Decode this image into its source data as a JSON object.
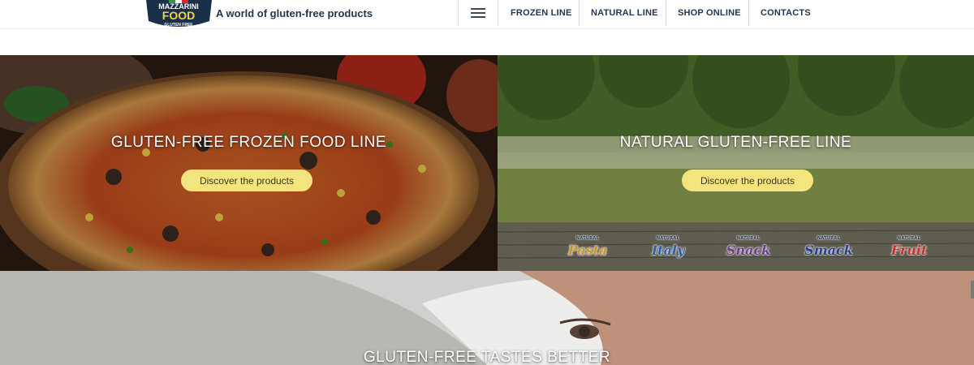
{
  "header": {
    "logo": {
      "line1": "MAZZARINI",
      "line2": "FOOD",
      "line3": "GLUTEN FREE"
    },
    "tagline": "A world of gluten-free products",
    "nav": [
      "FROZEN LINE",
      "NATURAL LINE",
      "SHOP ONLINE",
      "CONTACTS"
    ]
  },
  "panels": {
    "frozen": {
      "title": "GLUTEN-FREE FROZEN FOOD LINE",
      "cta": "Discover the products"
    },
    "natural": {
      "title": "NATURAL GLUTEN-FREE LINE",
      "cta": "Discover the products",
      "badges": [
        {
          "top": "NATURAL",
          "word": "Pasta",
          "color": "#c8952a"
        },
        {
          "top": "NATURAL",
          "word": "Italy",
          "color": "#2e5fa8"
        },
        {
          "top": "NATURAL",
          "word": "Snack",
          "color": "#6b3e8c"
        },
        {
          "top": "NATURAL",
          "word": "Smack",
          "color": "#2a3f8f"
        },
        {
          "top": "NATURAL",
          "word": "Fruit",
          "color": "#c53030"
        }
      ]
    },
    "bottom": {
      "title": "GLUTEN-FREE TASTES BETTER"
    }
  }
}
